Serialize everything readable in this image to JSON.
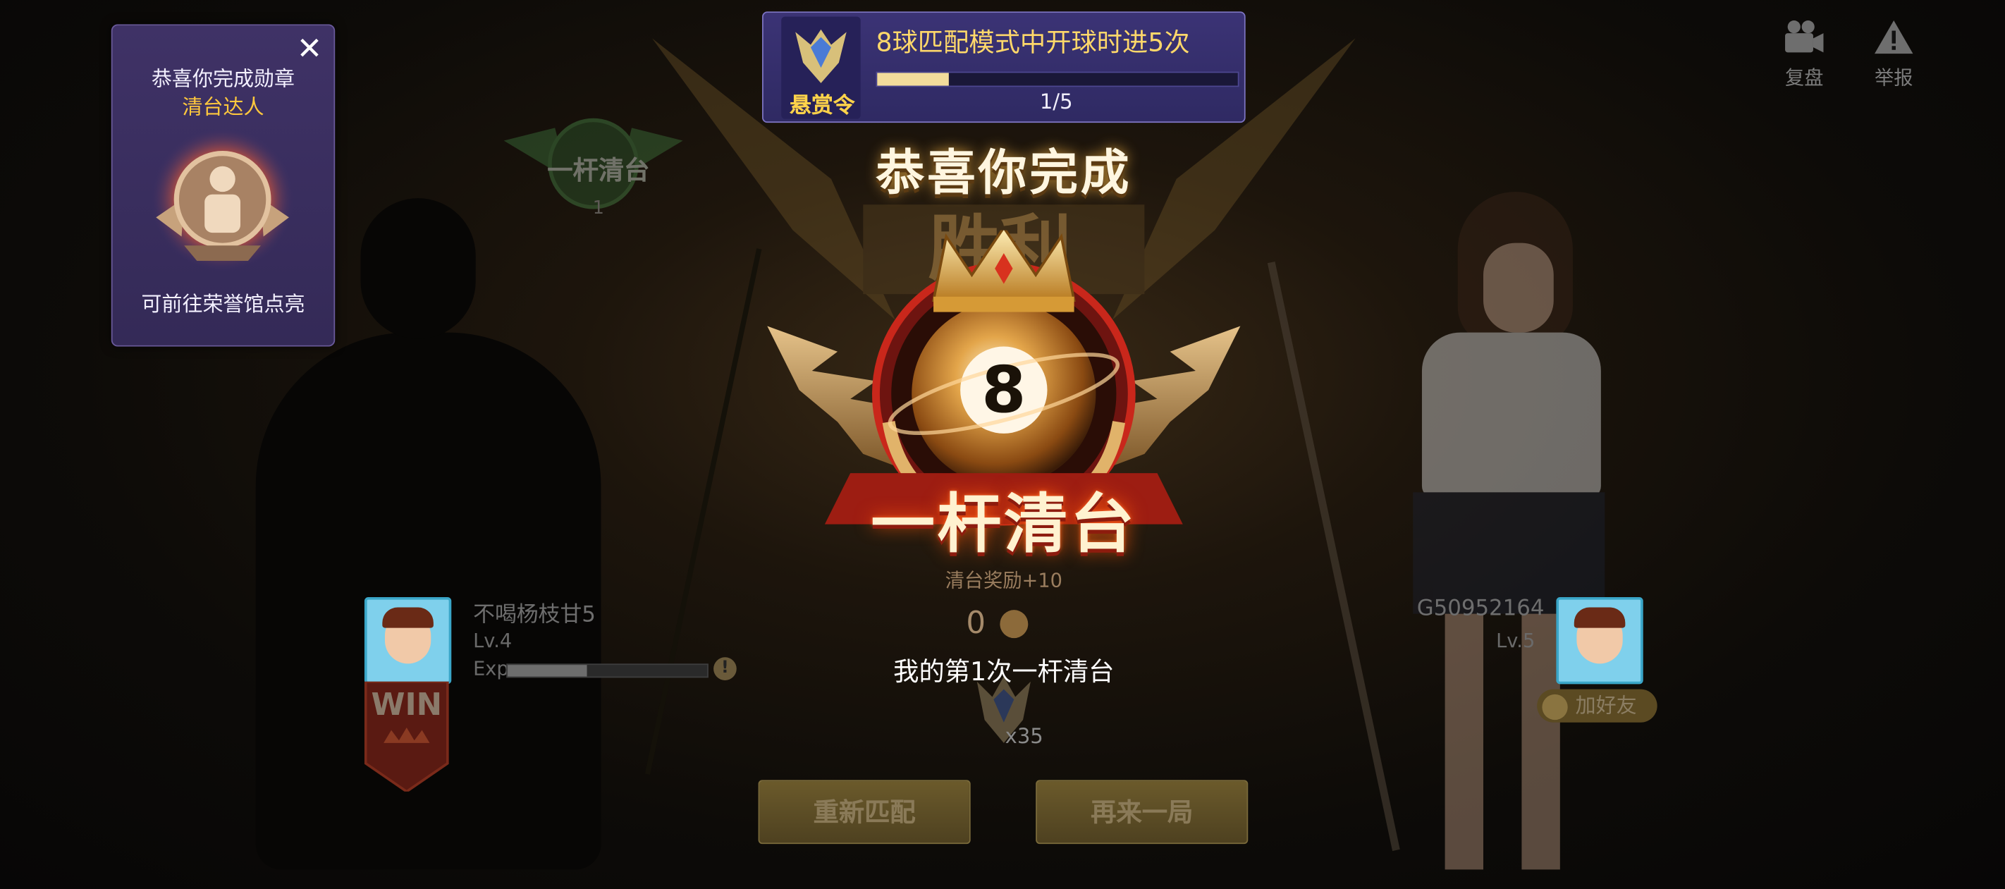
{
  "toolbar": {
    "replay_label": "复盘",
    "report_label": "举报",
    "replay_icon": "video-camera-icon",
    "report_icon": "warning-triangle-icon"
  },
  "medal_popup": {
    "line1": "恭喜你完成勋章",
    "medal_name": "清台达人",
    "hint": "可前往荣誉馆点亮",
    "close_icon": "close-icon"
  },
  "bounty": {
    "tag": "悬赏令",
    "title": "8球匹配模式中开球时进5次",
    "progress_fraction": 0.2,
    "progress_text": "1/5"
  },
  "achievement": {
    "congrats": "恭喜你完成",
    "ball_number": "8",
    "title": "一杆清台",
    "reward": "清台奖励+10",
    "reward_amount": "0",
    "first_time": "我的第1次一杆清台"
  },
  "top_badge": {
    "label": "一杆清台",
    "count": "1"
  },
  "player_left": {
    "name": "不喝杨枝甘5",
    "level": "Lv.4",
    "exp_label": "Exp",
    "exp_fraction": 0.4,
    "result": "WIN"
  },
  "player_right": {
    "name": "G50952164",
    "level": "Lv.5",
    "add_friend": "加好友"
  },
  "rank": {
    "multiplier": "x35"
  },
  "buttons": {
    "rematch": "重新匹配",
    "play_again": "再来一局"
  },
  "colors": {
    "gold": "#ffd34a",
    "purple_panel": "#3b3375",
    "flame_red": "#c9271b"
  }
}
